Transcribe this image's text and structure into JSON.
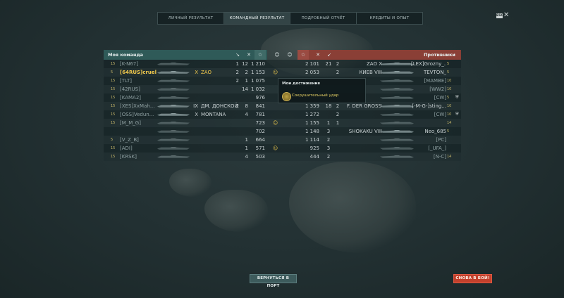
{
  "tabs": [
    "ЛИЧНЫЙ РЕЗУЛЬТАТ",
    "КОМАНДНЫЙ РЕЗУЛЬТАТ",
    "ПОДРОБНЫЙ ОТЧЁТ",
    "КРЕДИТЫ И ОПЫТ"
  ],
  "active_tab": 1,
  "esc_label": "ESC",
  "close_icon": "close-icon",
  "header": {
    "my_team": "Моя команда",
    "enemies": "Противники",
    "icons_left": [
      "ship-kills-icon",
      "planes-icon",
      "star-xp-icon",
      "achievement-icon"
    ],
    "icons_right": [
      "achievement-icon",
      "star-xp-icon",
      "planes-icon",
      "ship-kills-icon"
    ]
  },
  "left_rows": [
    {
      "lvl": "15",
      "player": "[K-N67]",
      "tier": "",
      "ship": "",
      "kills": "1",
      "planes": "12",
      "xp": "1 210",
      "ach": "",
      "dead": true,
      "me": false
    },
    {
      "lvl": "5",
      "player": "[64RUS]cruel",
      "tier": "X",
      "ship": "ZAO",
      "kills": "2",
      "planes": "2",
      "xp": "1 153",
      "ach": "☺",
      "dead": false,
      "me": true
    },
    {
      "lvl": "15",
      "player": "[TLT]",
      "tier": "",
      "ship": "",
      "kills": "2",
      "planes": "1",
      "xp": "1 075",
      "ach": "",
      "dead": true,
      "me": false
    },
    {
      "lvl": "15",
      "player": "[42RUS]",
      "tier": "",
      "ship": "",
      "kills": "",
      "planes": "14",
      "xp": "1 032",
      "ach": "",
      "dead": true,
      "me": false
    },
    {
      "lvl": "15",
      "player": "[KAMA2]",
      "tier": "",
      "ship": "",
      "kills": "",
      "planes": "",
      "xp": "976",
      "ach": "",
      "dead": true,
      "me": false
    },
    {
      "lvl": "15",
      "player": "[XES]XxMah...",
      "tier": "IX",
      "ship": "ДМ. ДОНСКОЙ",
      "kills": "2",
      "planes": "8",
      "xp": "841",
      "ach": "",
      "dead": false,
      "me": false
    },
    {
      "lvl": "15",
      "player": "[OSS]Vedun...",
      "tier": "X",
      "ship": "MONTANA",
      "kills": "",
      "planes": "4",
      "xp": "781",
      "ach": "",
      "dead": false,
      "me": false
    },
    {
      "lvl": "15",
      "player": "[M_M_G]",
      "tier": "",
      "ship": "",
      "kills": "",
      "planes": "",
      "xp": "723",
      "ach": "☺",
      "dead": true,
      "me": false
    },
    {
      "lvl": "",
      "player": "",
      "tier": "",
      "ship": "",
      "kills": "",
      "planes": "",
      "xp": "702",
      "ach": "",
      "dead": true,
      "me": false
    },
    {
      "lvl": "5",
      "player": "[V_Z_B]",
      "tier": "",
      "ship": "",
      "kills": "",
      "planes": "1",
      "xp": "664",
      "ach": "",
      "dead": true,
      "me": false
    },
    {
      "lvl": "15",
      "player": "[ADI]",
      "tier": "",
      "ship": "",
      "kills": "",
      "planes": "1",
      "xp": "571",
      "ach": "☺",
      "dead": true,
      "me": false
    },
    {
      "lvl": "15",
      "player": "[KRSK]",
      "tier": "",
      "ship": "",
      "kills": "",
      "planes": "4",
      "xp": "503",
      "ach": "",
      "dead": true,
      "me": false
    }
  ],
  "right_rows": [
    {
      "xp": "2 101",
      "planes": "21",
      "kills": "2",
      "tier": "ZAO",
      "ship": "X",
      "player": "[LEX]Grozny_...",
      "lvl": "5",
      "icon": "",
      "dead": false
    },
    {
      "xp": "2 053",
      "planes": "",
      "kills": "2",
      "tier": "КИЕВ",
      "ship": "VIII",
      "player": "TEVTON_",
      "lvl": "5",
      "icon": "",
      "dead": false
    },
    {
      "xp": "",
      "planes": "",
      "kills": "",
      "tier": "",
      "ship": "",
      "player": "[MAMBE]",
      "lvl": "10",
      "icon": "",
      "dead": true
    },
    {
      "xp": "",
      "planes": "",
      "kills": "",
      "tier": "",
      "ship": "",
      "player": "[WW2]",
      "lvl": "10",
      "icon": "",
      "dead": true
    },
    {
      "xp": "",
      "planes": "",
      "kills": "",
      "tier": "",
      "ship": "",
      "player": "[CW]",
      "lvl": "5",
      "icon": "⛨",
      "dead": true
    },
    {
      "xp": "1 359",
      "planes": "18",
      "kills": "2",
      "tier": "F. DER GROSSE",
      "ship": "IX",
      "player": "[-M-G-]sting...",
      "lvl": "10",
      "icon": "",
      "dead": false
    },
    {
      "xp": "1 272",
      "planes": "",
      "kills": "2",
      "tier": "",
      "ship": "",
      "player": "[CW]",
      "lvl": "10",
      "icon": "⛨",
      "dead": true
    },
    {
      "xp": "1 155",
      "planes": "1",
      "kills": "1",
      "tier": "",
      "ship": "",
      "player": "",
      "lvl": "14",
      "icon": "",
      "dead": true
    },
    {
      "xp": "1 148",
      "planes": "3",
      "kills": "",
      "tier": "SHOKAKU",
      "ship": "VIII",
      "player": "Neo_685",
      "lvl": "5",
      "icon": "",
      "dead": false
    },
    {
      "xp": "1 114",
      "planes": "2",
      "kills": "",
      "tier": "",
      "ship": "",
      "player": "[PC]",
      "lvl": "",
      "icon": "",
      "dead": true
    },
    {
      "xp": "925",
      "planes": "3",
      "kills": "",
      "tier": "",
      "ship": "",
      "player": "[_UFA_]",
      "lvl": "",
      "icon": "",
      "dead": true
    },
    {
      "xp": "444",
      "planes": "2",
      "kills": "",
      "tier": "",
      "ship": "",
      "player": "[N-C]",
      "lvl": "14",
      "icon": "",
      "dead": true
    }
  ],
  "tooltip": {
    "title": "Мои достижения",
    "item": "Сокрушительный удар"
  },
  "buttons": {
    "return_port": "ВЕРНУТЬСЯ В ПОРТ",
    "battle_again": "СНОВА В БОЙ!"
  },
  "colors": {
    "my_team": "#2f5a58",
    "enemies": "#8a3f36",
    "me_highlight": "#f2c94c",
    "battle_button": "#c2402c"
  }
}
